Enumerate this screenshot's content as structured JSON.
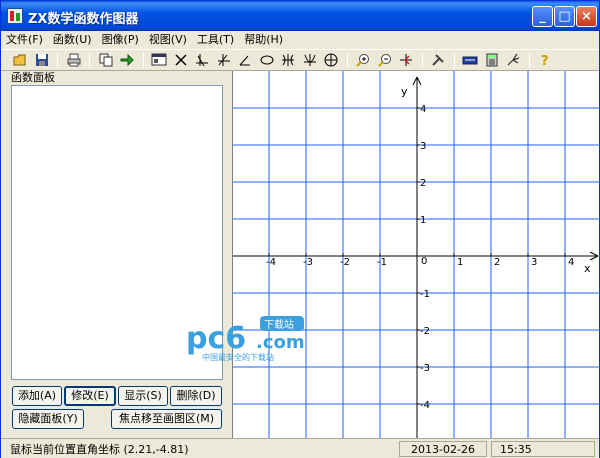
{
  "window": {
    "title": "ZX数学函数作图器"
  },
  "menu": [
    "文件(F)",
    "函数(U)",
    "图像(P)",
    "视图(V)",
    "工具(T)",
    "帮助(H)"
  ],
  "toolbar": [
    "open-icon",
    "save-icon",
    "print-icon",
    "copy-icon",
    "export-icon",
    "window-icon",
    "cross-icon",
    "axis-icon",
    "axis-offset-icon",
    "angle-icon",
    "ellipse-icon",
    "hyperbola-icon",
    "parabola-icon",
    "target-icon",
    "zoom-in-icon",
    "zoom-out-icon",
    "move-icon",
    "tools-icon",
    "keyboard-icon",
    "calculator-icon",
    "brush-icon",
    "help-icon"
  ],
  "panel": {
    "label": "函数面板",
    "add": "添加(A)",
    "edit": "修改(E)",
    "show": "显示(S)",
    "delete": "删除(D)",
    "hide": "隐藏面板(Y)",
    "focus": "焦点移至画图区(M)"
  },
  "graph": {
    "x_label": "x",
    "y_label": "y",
    "origin": "0",
    "x_ticks": [
      -4,
      -3,
      -2,
      -1,
      1,
      2,
      3,
      4
    ],
    "y_ticks": [
      4,
      3,
      2,
      1,
      -1,
      -2,
      -3,
      -4
    ],
    "grid_color": "#1e64ff",
    "axis_color": "#000000"
  },
  "status": {
    "coords": "鼠标当前位置直角坐标 (2.21,-4.81)",
    "date": "2013-02-26",
    "time": "15:35"
  },
  "watermark": {
    "brand": "pc6",
    "domain": ".com",
    "badge": "下载站",
    "tagline": "中国最安全的下载站"
  }
}
